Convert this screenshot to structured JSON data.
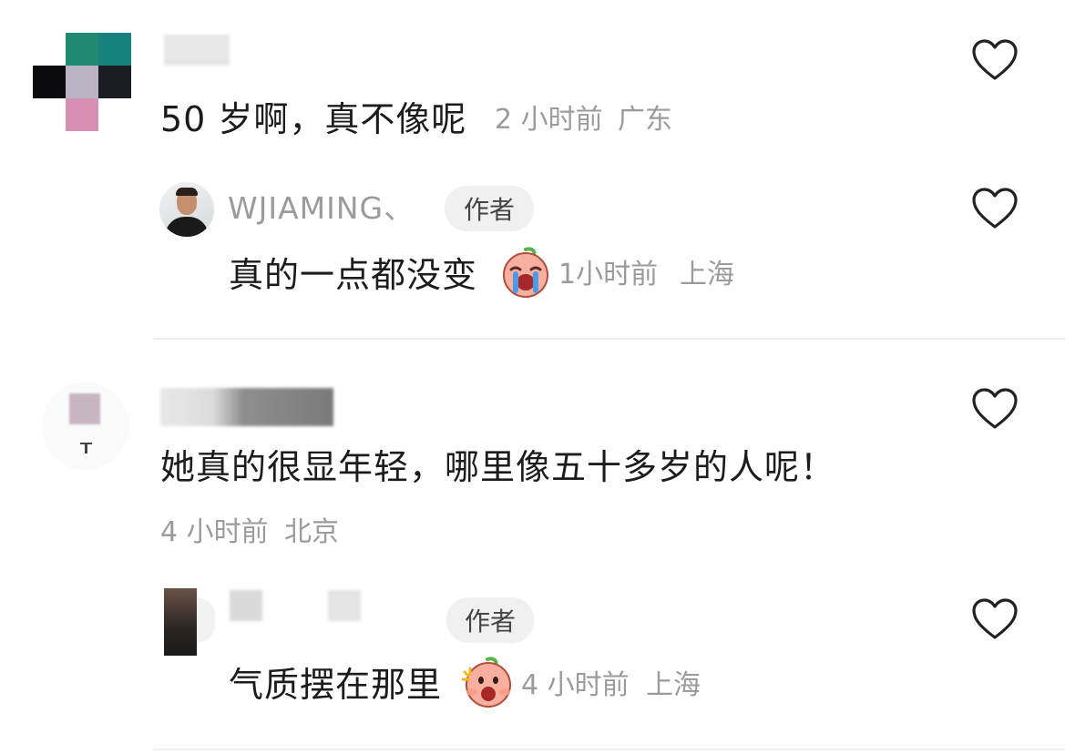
{
  "comments": [
    {
      "text": "50 岁啊，真不像呢",
      "time": "2 小时前",
      "location": "广东",
      "reply": {
        "username": "WJIAMING、",
        "badge": "作者",
        "text": "真的一点都没变",
        "time": "1小时前",
        "location": "上海",
        "emoji": "crying-face-emoji"
      }
    },
    {
      "text": "她真的很显年轻，哪里像五十多岁的人呢！",
      "time": "4 小时前",
      "location": "北京",
      "reply": {
        "badge": "作者",
        "text": "气质摆在那里",
        "time": "4 小时前",
        "location": "上海",
        "emoji": "shocked-face-emoji"
      }
    }
  ],
  "icons": {
    "like": "heart-outline-icon"
  },
  "colors": {
    "text": "#1c1c1c",
    "meta": "#9b9b9b",
    "badge_bg": "#f0f0f0",
    "divider": "#eeeeee"
  }
}
